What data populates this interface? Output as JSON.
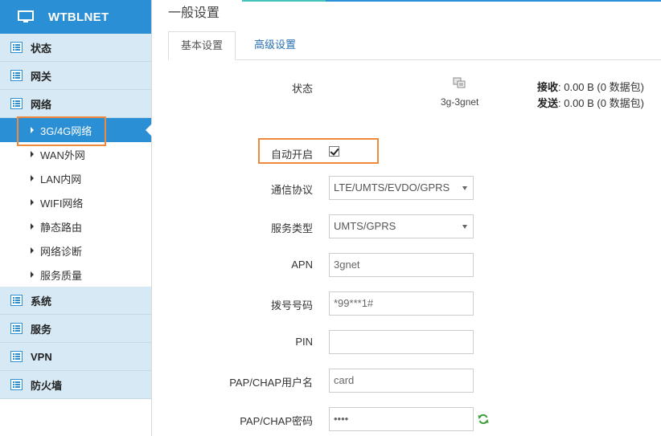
{
  "brand": {
    "title": "WTBLNET",
    "icon": "monitor-icon"
  },
  "sidebar": {
    "sections_top": [
      {
        "label": "状态"
      },
      {
        "label": "网关"
      },
      {
        "label": "网络"
      }
    ],
    "network_items": [
      {
        "label": "3G/4G网络",
        "active": true
      },
      {
        "label": "WAN外网"
      },
      {
        "label": "LAN内网"
      },
      {
        "label": "WIFI网络"
      },
      {
        "label": "静态路由"
      },
      {
        "label": "网络诊断"
      },
      {
        "label": "服务质量"
      }
    ],
    "sections_bottom": [
      {
        "label": "系统"
      },
      {
        "label": "服务"
      },
      {
        "label": "VPN"
      },
      {
        "label": "防火墙"
      }
    ]
  },
  "page": {
    "title": "一般设置",
    "tabs": [
      {
        "label": "基本设置",
        "active": true
      },
      {
        "label": "高级设置",
        "active": false
      }
    ]
  },
  "status": {
    "label": "状态",
    "interface_name": "3g-3gnet",
    "rx_label": "接收",
    "rx_value": ": 0.00 B (0 数据包)",
    "tx_label": "发送",
    "tx_value": ": 0.00 B (0 数据包)"
  },
  "form": {
    "auto_start": {
      "label": "自动开启",
      "checked": true
    },
    "protocol": {
      "label": "通信协议",
      "value": "LTE/UMTS/EVDO/GPRS"
    },
    "service_type": {
      "label": "服务类型",
      "value": "UMTS/GPRS"
    },
    "apn": {
      "label": "APN",
      "value": "3gnet"
    },
    "dial_number": {
      "label": "拨号号码",
      "value": "*99***1#"
    },
    "pin": {
      "label": "PIN",
      "value": ""
    },
    "pap_user": {
      "label": "PAP/CHAP用户名",
      "value": "card"
    },
    "pap_password": {
      "label": "PAP/CHAP密码",
      "value": "••••"
    }
  },
  "colors": {
    "accent": "#2a8fd4",
    "section_bg": "#d7e9f5",
    "highlight": "#ef8a3c"
  }
}
